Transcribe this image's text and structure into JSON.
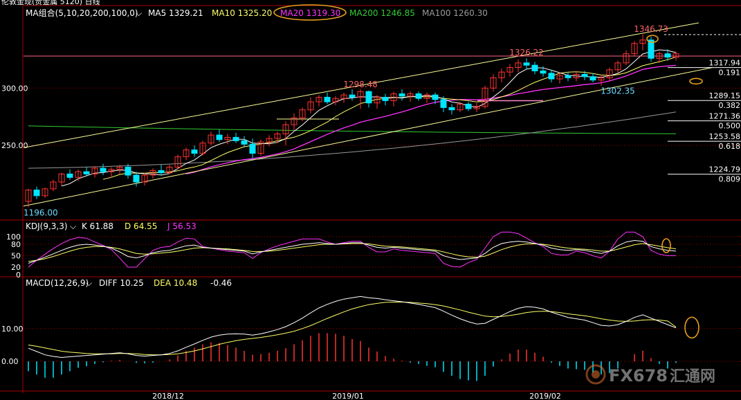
{
  "window": {
    "title": "伦敦金现(贵金属 5120) 日线"
  },
  "colors": {
    "bg": "#000000",
    "up": "#ff3333",
    "down": "#00e5ff",
    "ma5": "#ffffff",
    "ma10": "#ffff66",
    "ma20": "#ff33ff",
    "ma200": "#33cc33",
    "ma100": "#999999",
    "kdj_k": "#ffffff",
    "kdj_d": "#ffff66",
    "kdj_j": "#ff33ff",
    "grid": "#aa0000",
    "annotation": "#e8a020",
    "fib": "#ffffff"
  },
  "legend": {
    "ma_group": "MA组合(5,10,20,200,100,0)",
    "ma5": "MA5 1329.21",
    "ma10": "MA10 1325.20",
    "ma20": "MA20 1319.30",
    "ma200": "MA200 1246.85",
    "ma100": "MA100 1260.30",
    "kdj": "KDJ(9,3,3)",
    "kdj_k": "K 61.88",
    "kdj_d": "D 64.55",
    "kdj_j": "J 56.53",
    "macd": "MACD(12,26,9)",
    "macd_diff": "DIFF 10.25",
    "macd_dea": "DEA 10.48",
    "macd_hist": "-0.46"
  },
  "chart_data": {
    "type": "candlestick",
    "price_axis_labels": [
      "300.00",
      "250.00"
    ],
    "price_axis_values": [
      1300,
      1250
    ],
    "price_range": [
      1192,
      1360
    ],
    "kdj_axis_labels": [
      "100",
      "80",
      "50",
      "20",
      "0"
    ],
    "kdj_axis_values": [
      100,
      80,
      50,
      20,
      0
    ],
    "macd_axis_labels": [
      "10.00",
      "0.00"
    ],
    "macd_axis_values": [
      10,
      0
    ],
    "macd_range": [
      -8,
      22
    ],
    "x_labels": [
      "2018/12",
      "2019/01",
      "2019/02"
    ],
    "annotations": [
      {
        "label": "1346.73",
        "price": 1346.73,
        "index": 75
      },
      {
        "label": "1326.22",
        "price": 1326.22,
        "index": 60
      },
      {
        "label": "1298.48",
        "price": 1298.48,
        "index": 40
      },
      {
        "label": "1302.35",
        "price": 1302.35,
        "index": 71
      },
      {
        "label": "1196.00",
        "price": 1196.0,
        "index": 0
      }
    ],
    "fib_levels": [
      {
        "price": 1317.94,
        "label": "1317.94",
        "ratio": "0.191"
      },
      {
        "price": 1289.15,
        "label": "1289.15",
        "ratio": "0.382"
      },
      {
        "price": 1271.36,
        "label": "1271.36",
        "ratio": "0.500"
      },
      {
        "price": 1253.58,
        "label": "1253.58",
        "ratio": "0.618"
      },
      {
        "price": 1224.79,
        "label": "1224.79",
        "ratio": "0.809"
      }
    ],
    "candles": [
      [
        1201,
        1212,
        1196,
        1211
      ],
      [
        1211,
        1214,
        1203,
        1206
      ],
      [
        1206,
        1213,
        1204,
        1212
      ],
      [
        1212,
        1220,
        1210,
        1218
      ],
      [
        1218,
        1226,
        1215,
        1225
      ],
      [
        1225,
        1229,
        1220,
        1222
      ],
      [
        1222,
        1229,
        1219,
        1227
      ],
      [
        1227,
        1231,
        1223,
        1225
      ],
      [
        1225,
        1232,
        1222,
        1230
      ],
      [
        1230,
        1234,
        1224,
        1227
      ],
      [
        1227,
        1231,
        1222,
        1229
      ],
      [
        1229,
        1233,
        1225,
        1231
      ],
      [
        1231,
        1234,
        1221,
        1224
      ],
      [
        1224,
        1227,
        1214,
        1218
      ],
      [
        1218,
        1226,
        1215,
        1224
      ],
      [
        1224,
        1230,
        1221,
        1228
      ],
      [
        1228,
        1233,
        1224,
        1226
      ],
      [
        1226,
        1233,
        1225,
        1231
      ],
      [
        1231,
        1242,
        1229,
        1240
      ],
      [
        1240,
        1248,
        1237,
        1246
      ],
      [
        1246,
        1250,
        1240,
        1243
      ],
      [
        1243,
        1254,
        1241,
        1252
      ],
      [
        1252,
        1262,
        1250,
        1259
      ],
      [
        1259,
        1264,
        1253,
        1255
      ],
      [
        1255,
        1260,
        1251,
        1257
      ],
      [
        1257,
        1261,
        1252,
        1254
      ],
      [
        1254,
        1258,
        1249,
        1251
      ],
      [
        1251,
        1256,
        1239,
        1243
      ],
      [
        1243,
        1255,
        1241,
        1253
      ],
      [
        1253,
        1259,
        1249,
        1256
      ],
      [
        1256,
        1262,
        1252,
        1260
      ],
      [
        1260,
        1271,
        1250,
        1268
      ],
      [
        1268,
        1278,
        1262,
        1274
      ],
      [
        1274,
        1283,
        1271,
        1281
      ],
      [
        1281,
        1292,
        1278,
        1288
      ],
      [
        1288,
        1294,
        1284,
        1292
      ],
      [
        1292,
        1296,
        1286,
        1288
      ],
      [
        1288,
        1293,
        1285,
        1291
      ],
      [
        1291,
        1296,
        1287,
        1294
      ],
      [
        1294,
        1299,
        1289,
        1292
      ],
      [
        1292,
        1299,
        1282,
        1297
      ],
      [
        1297,
        1298,
        1283,
        1287
      ],
      [
        1287,
        1294,
        1282,
        1292
      ],
      [
        1292,
        1295,
        1285,
        1289
      ],
      [
        1289,
        1297,
        1284,
        1295
      ],
      [
        1295,
        1299,
        1289,
        1293
      ],
      [
        1293,
        1297,
        1288,
        1295
      ],
      [
        1295,
        1297,
        1289,
        1291
      ],
      [
        1291,
        1296,
        1287,
        1294
      ],
      [
        1294,
        1296,
        1286,
        1290
      ],
      [
        1290,
        1293,
        1279,
        1283
      ],
      [
        1283,
        1286,
        1277,
        1281
      ],
      [
        1281,
        1288,
        1279,
        1286
      ],
      [
        1286,
        1288,
        1280,
        1282
      ],
      [
        1282,
        1287,
        1279,
        1284
      ],
      [
        1284,
        1302,
        1282,
        1300
      ],
      [
        1300,
        1312,
        1297,
        1309
      ],
      [
        1309,
        1317,
        1305,
        1314
      ],
      [
        1314,
        1321,
        1310,
        1318
      ],
      [
        1318,
        1325,
        1314,
        1322
      ],
      [
        1322,
        1326,
        1316,
        1320
      ],
      [
        1320,
        1323,
        1312,
        1315
      ],
      [
        1315,
        1319,
        1310,
        1313
      ],
      [
        1313,
        1316,
        1305,
        1308
      ],
      [
        1308,
        1314,
        1304,
        1311
      ],
      [
        1311,
        1314,
        1306,
        1309
      ],
      [
        1309,
        1315,
        1306,
        1312
      ],
      [
        1312,
        1315,
        1307,
        1310
      ],
      [
        1310,
        1313,
        1305,
        1307
      ],
      [
        1307,
        1312,
        1302,
        1309
      ],
      [
        1309,
        1318,
        1306,
        1316
      ],
      [
        1316,
        1324,
        1313,
        1322
      ],
      [
        1322,
        1333,
        1320,
        1330
      ],
      [
        1330,
        1341,
        1328,
        1339
      ],
      [
        1339,
        1347,
        1333,
        1342
      ],
      [
        1342,
        1345,
        1323,
        1326
      ],
      [
        1326,
        1332,
        1322,
        1330
      ],
      [
        1330,
        1334,
        1324,
        1327
      ],
      [
        1327,
        1332,
        1324,
        1330
      ]
    ],
    "kdj_k": [
      30,
      38,
      46,
      55,
      64,
      72,
      78,
      80,
      78,
      75,
      70,
      60,
      48,
      44,
      50,
      58,
      62,
      64,
      70,
      76,
      78,
      72,
      70,
      68,
      66,
      64,
      62,
      55,
      60,
      64,
      68,
      72,
      76,
      80,
      82,
      84,
      82,
      80,
      82,
      84,
      84,
      78,
      72,
      70,
      72,
      70,
      68,
      66,
      64,
      62,
      50,
      44,
      40,
      42,
      44,
      56,
      72,
      82,
      86,
      88,
      86,
      82,
      78,
      70,
      66,
      64,
      66,
      64,
      60,
      56,
      62,
      76,
      86,
      90,
      88,
      74,
      68,
      64,
      62
    ],
    "kdj_d": [
      35,
      38,
      42,
      48,
      55,
      62,
      68,
      72,
      74,
      74,
      72,
      68,
      62,
      56,
      54,
      55,
      57,
      59,
      62,
      66,
      70,
      71,
      70,
      69,
      68,
      66,
      64,
      61,
      61,
      62,
      64,
      67,
      70,
      73,
      76,
      79,
      80,
      80,
      81,
      82,
      82,
      81,
      78,
      75,
      74,
      73,
      71,
      69,
      67,
      65,
      60,
      55,
      50,
      47,
      46,
      49,
      57,
      66,
      73,
      78,
      81,
      81,
      80,
      77,
      73,
      70,
      68,
      67,
      65,
      62,
      62,
      67,
      73,
      79,
      82,
      79,
      75,
      71,
      68
    ],
    "kdj_j": [
      20,
      38,
      54,
      69,
      82,
      92,
      98,
      96,
      86,
      77,
      66,
      44,
      20,
      20,
      42,
      64,
      72,
      74,
      86,
      96,
      94,
      74,
      70,
      66,
      62,
      60,
      58,
      43,
      58,
      68,
      76,
      82,
      88,
      94,
      94,
      94,
      86,
      80,
      84,
      88,
      88,
      72,
      60,
      60,
      68,
      64,
      62,
      60,
      58,
      56,
      30,
      22,
      20,
      32,
      40,
      70,
      100,
      112,
      112,
      108,
      96,
      84,
      74,
      56,
      52,
      52,
      62,
      58,
      50,
      44,
      62,
      94,
      112,
      112,
      100,
      64,
      54,
      50,
      50
    ],
    "macd_diff": [
      4,
      3,
      2,
      1.5,
      1.2,
      1.4,
      1.6,
      1.8,
      2,
      2.2,
      2.4,
      2.6,
      2.3,
      1.8,
      1.6,
      1.8,
      2,
      2.4,
      3.2,
      4.3,
      5.3,
      6.4,
      7.4,
      8,
      8.3,
      8.4,
      8.3,
      8,
      8.4,
      9,
      9.7,
      10.6,
      11.8,
      13.2,
      14.8,
      16.3,
      17.4,
      18.3,
      19,
      19.4,
      19.8,
      19.4,
      19.2,
      18.8,
      18.5,
      18.2,
      17.8,
      17.4,
      16.9,
      16.4,
      15.3,
      14.1,
      13,
      12.1,
      11.4,
      11.6,
      12.8,
      14,
      15.2,
      16.2,
      16.7,
      16.5,
      16,
      15,
      14.2,
      13.4,
      13,
      12.6,
      11.8,
      11,
      10.8,
      11.2,
      12.2,
      13.4,
      14.2,
      13.2,
      12.2,
      11.2,
      10.25
    ],
    "macd_dea": [
      5,
      4.6,
      4.1,
      3.6,
      3.1,
      2.8,
      2.6,
      2.4,
      2.3,
      2.3,
      2.3,
      2.4,
      2.4,
      2.3,
      2.1,
      2,
      2,
      2.1,
      2.3,
      2.7,
      3.2,
      3.8,
      4.5,
      5.2,
      5.8,
      6.3,
      6.7,
      7,
      7.3,
      7.7,
      8.1,
      8.6,
      9.2,
      10,
      10.9,
      12,
      13.1,
      14.1,
      15.1,
      16,
      16.7,
      17.3,
      17.7,
      18,
      18.1,
      18.1,
      18,
      17.8,
      17.6,
      17.3,
      16.9,
      16.3,
      15.7,
      15,
      14.4,
      13.8,
      13.6,
      13.7,
      14,
      14.4,
      14.9,
      15.2,
      15.3,
      15.2,
      14.9,
      14.5,
      14.2,
      13.9,
      13.5,
      13,
      12.6,
      12.3,
      12.2,
      12.3,
      12.6,
      12.7,
      12.6,
      12.3,
      10.48
    ],
    "macd_hist": [
      -3,
      -4,
      -5,
      -5,
      -4,
      -3,
      -2,
      -1.5,
      -0.8,
      -0.3,
      0.2,
      0.4,
      0,
      -0.5,
      -0.6,
      -0.4,
      0,
      0.6,
      1.8,
      3.2,
      4.2,
      5.2,
      5.8,
      5.6,
      5,
      4.2,
      3.2,
      2,
      2.2,
      2.6,
      3.2,
      4,
      5.2,
      6.4,
      7.8,
      8.6,
      8.6,
      8.4,
      7.8,
      6.8,
      6.2,
      4.2,
      3,
      1.6,
      0.8,
      0.2,
      -0.4,
      -0.8,
      -1.4,
      -1.8,
      -3.2,
      -4.4,
      -5.4,
      -5.8,
      -6,
      -4.4,
      -1.6,
      0.6,
      2.4,
      3.6,
      3.6,
      2.6,
      1.4,
      -0.4,
      -1.4,
      -2.2,
      -2.4,
      -2.6,
      -3.4,
      -4,
      -3.6,
      -2.2,
      0,
      2.2,
      3.2,
      1,
      -0.8,
      -2.2,
      -0.46
    ]
  }
}
